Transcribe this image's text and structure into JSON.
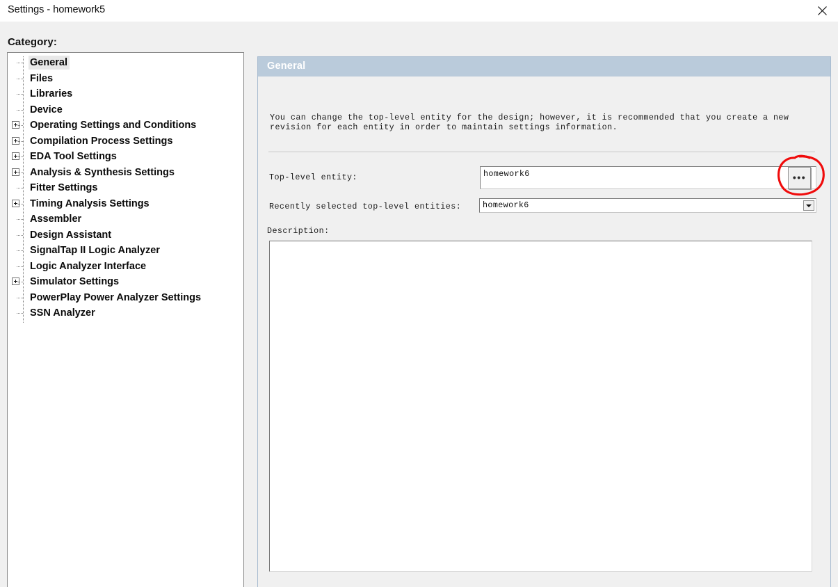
{
  "window": {
    "title": "Settings - homework5",
    "close_icon": "close-icon"
  },
  "sidebar": {
    "heading": "Category:",
    "items": [
      {
        "label": "General",
        "expandable": false,
        "selected": true
      },
      {
        "label": "Files",
        "expandable": false,
        "selected": false
      },
      {
        "label": "Libraries",
        "expandable": false,
        "selected": false
      },
      {
        "label": "Device",
        "expandable": false,
        "selected": false
      },
      {
        "label": "Operating Settings and Conditions",
        "expandable": true,
        "selected": false
      },
      {
        "label": "Compilation Process Settings",
        "expandable": true,
        "selected": false
      },
      {
        "label": "EDA Tool Settings",
        "expandable": true,
        "selected": false
      },
      {
        "label": "Analysis & Synthesis Settings",
        "expandable": true,
        "selected": false
      },
      {
        "label": "Fitter Settings",
        "expandable": false,
        "selected": false
      },
      {
        "label": "Timing Analysis Settings",
        "expandable": true,
        "selected": false
      },
      {
        "label": "Assembler",
        "expandable": false,
        "selected": false
      },
      {
        "label": "Design Assistant",
        "expandable": false,
        "selected": false
      },
      {
        "label": "SignalTap II Logic Analyzer",
        "expandable": false,
        "selected": false
      },
      {
        "label": "Logic Analyzer Interface",
        "expandable": false,
        "selected": false
      },
      {
        "label": "Simulator Settings",
        "expandable": true,
        "selected": false
      },
      {
        "label": "PowerPlay Power Analyzer Settings",
        "expandable": false,
        "selected": false
      },
      {
        "label": "SSN Analyzer",
        "expandable": false,
        "selected": false
      }
    ]
  },
  "panel": {
    "header": "General",
    "description": "You can change the top-level entity for the design; however, it is recommended that you create a new revision for each entity in order to maintain settings information.",
    "fields": {
      "top_level_entity_label": "Top-level entity:",
      "top_level_entity_value": "homework6",
      "browse_button_label": "•••",
      "recent_entities_label": "Recently selected top-level entities:",
      "recent_entities_value": "homework6",
      "description_label": "Description:",
      "description_value": ""
    }
  },
  "annotation": {
    "shape": "hand-drawn-circle",
    "color": "#f00b0b",
    "target": "browse-button"
  },
  "colors": {
    "panel_header_bg": "#bacbdb",
    "dialog_bg": "#f0f0f0",
    "titlebar_bg": "#ffffff",
    "annotation_red": "#f00b0b"
  }
}
